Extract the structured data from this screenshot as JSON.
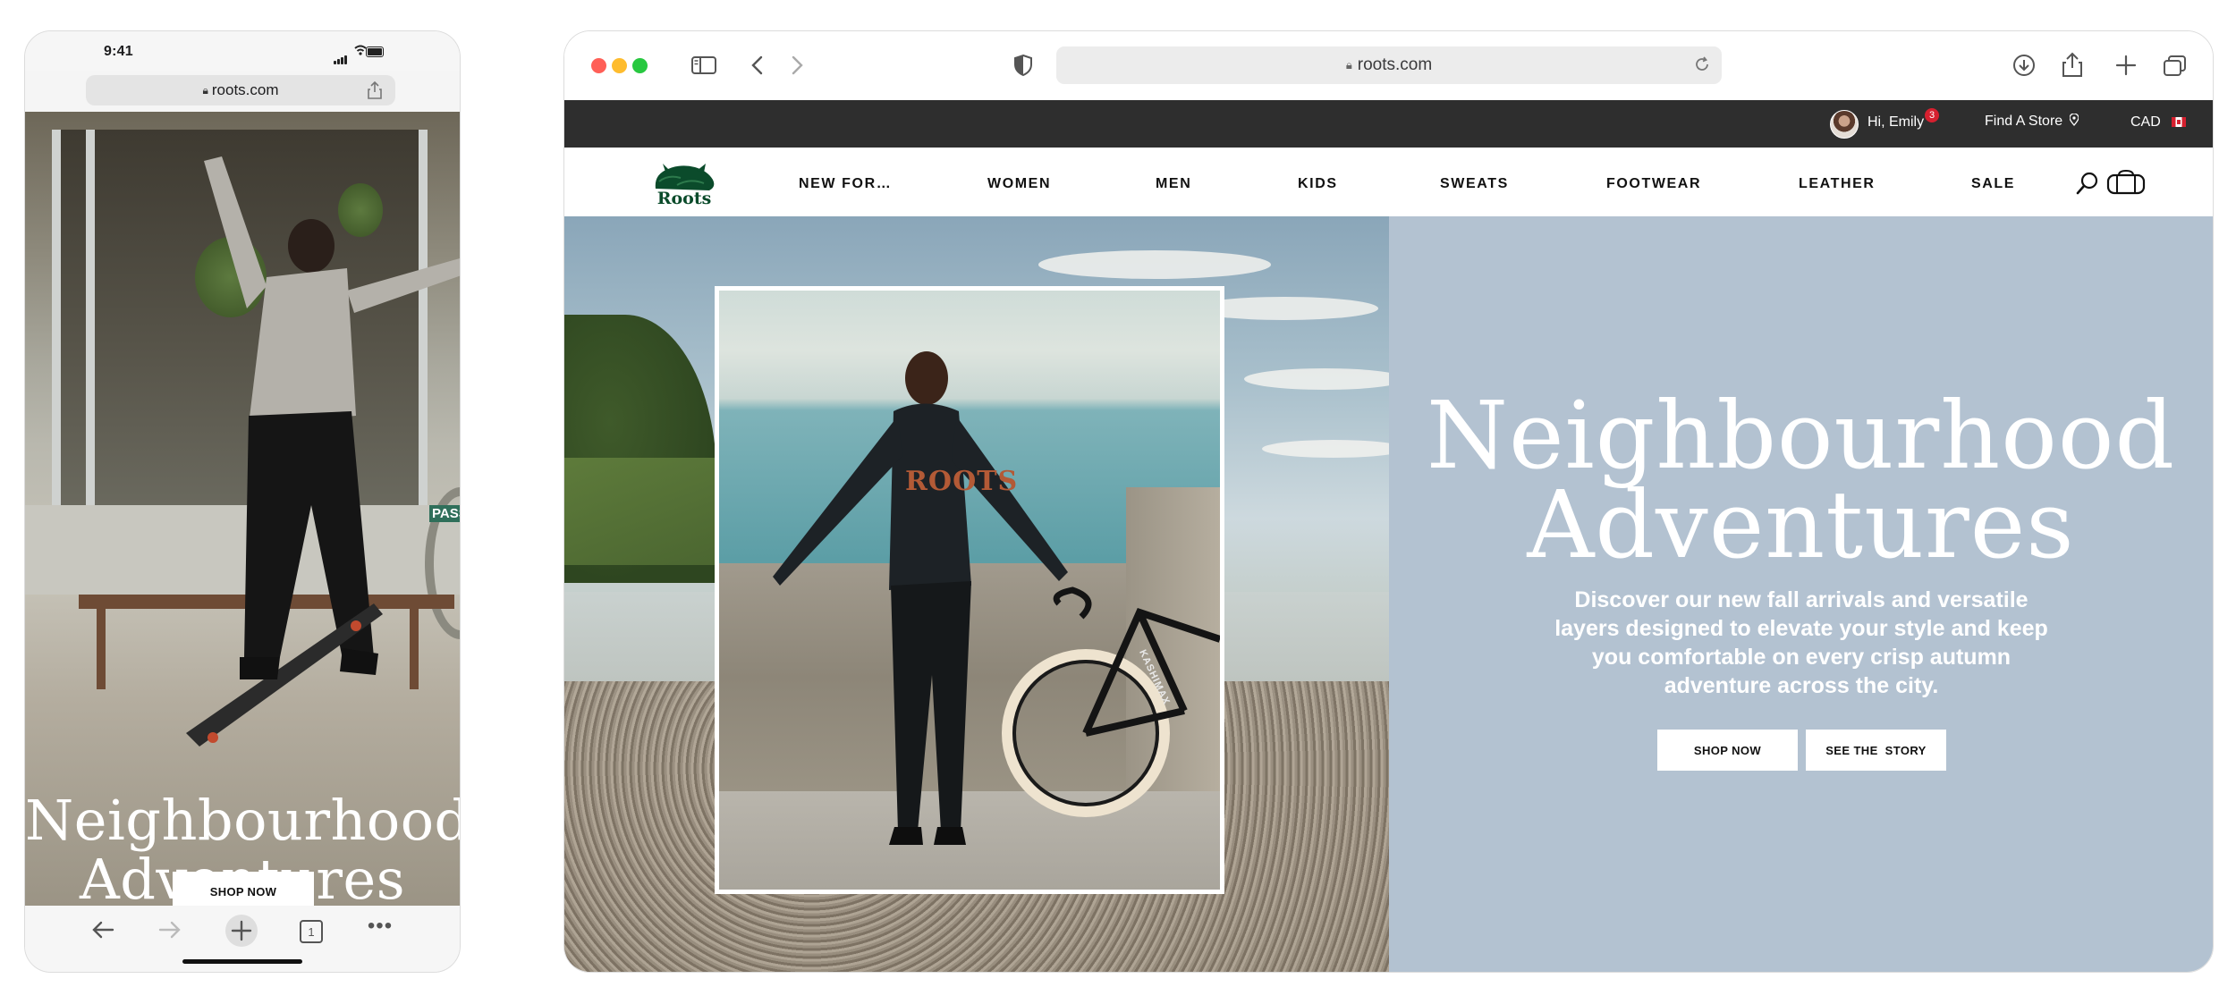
{
  "phone": {
    "status": {
      "time": "9:41"
    },
    "url": "roots.com",
    "hero": {
      "title_line1": "Neighbourhood",
      "title_line2": "Adventures",
      "shop_now": "SHOP NOW",
      "sign_text": "PASS"
    },
    "toolbar": {
      "tab_count": "1"
    }
  },
  "browser": {
    "url": "roots.com",
    "util_bar": {
      "greeting": "Hi, Emily",
      "badge_count": "3",
      "find_store": "Find A Store",
      "currency": "CAD"
    },
    "nav": {
      "logo_text": "Roots",
      "items": [
        "NEW FOR…",
        "WOMEN",
        "MEN",
        "KIDS",
        "SWEATS",
        "FOOTWEAR",
        "LEATHER",
        "SALE"
      ]
    },
    "hero": {
      "title_line1": "Neighbourhood",
      "title_line2": "Adventures",
      "subtitle": "Discover our new fall arrivals and versatile layers designed to elevate your style and keep you comfortable on every crisp autumn adventure across the city.",
      "shop_now": "SHOP NOW",
      "see_story": "SEE THE  STORY",
      "shirt_text": "ROOTS",
      "bike_text": "KASHIMAX"
    }
  },
  "colors": {
    "util_bar": "#2e2e2e",
    "hero_panel": "#b3c2d1",
    "brand_green": "#0b4b2b",
    "badge_red": "#d6202f",
    "traffic_red": "#ff5f57",
    "traffic_yellow": "#febc2e",
    "traffic_green": "#28c840"
  },
  "icons": [
    "sidebar-icon",
    "back-icon",
    "forward-icon",
    "shield-icon",
    "lock-icon",
    "reload-icon",
    "download-icon",
    "share-icon",
    "plus-icon",
    "tabs-icon",
    "pin-icon",
    "search-icon",
    "bag-icon",
    "ellipsis-icon"
  ]
}
